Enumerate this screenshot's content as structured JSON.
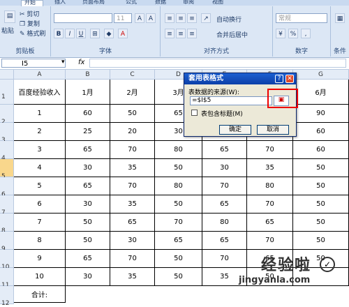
{
  "ribbon": {
    "tabs": [
      "开始",
      "插入",
      "页面布局",
      "公式",
      "数据",
      "审阅",
      "视图"
    ],
    "clipboard": {
      "paste": "粘贴",
      "cut": "剪切",
      "copy": "复制",
      "format_painter": "格式刷",
      "label": "剪贴板"
    },
    "font": {
      "size": "11",
      "label": "字体",
      "bold": "B",
      "italic": "I",
      "underline": "U"
    },
    "alignment": {
      "wrap": "自动换行",
      "merge": "合并后居中",
      "label": "对齐方式"
    },
    "number": {
      "format": "常规",
      "label": "数字",
      "percent": "%",
      "comma": ","
    },
    "styles_label": "条件"
  },
  "formula_bar": {
    "cell": "I5",
    "fx": "fx"
  },
  "sheet": {
    "columns": [
      "A",
      "B",
      "C",
      "D",
      "E",
      "F",
      "G"
    ],
    "header_row": [
      "百度经验收入",
      "1月",
      "2月",
      "3月",
      "",
      "",
      "6月"
    ],
    "rows": [
      [
        "1",
        "60",
        "50",
        "65",
        "",
        "",
        "90"
      ],
      [
        "2",
        "25",
        "20",
        "30",
        "",
        "",
        "60"
      ],
      [
        "3",
        "65",
        "70",
        "80",
        "65",
        "70",
        "60"
      ],
      [
        "4",
        "30",
        "35",
        "50",
        "30",
        "35",
        "50"
      ],
      [
        "5",
        "65",
        "70",
        "80",
        "70",
        "80",
        "50"
      ],
      [
        "6",
        "30",
        "35",
        "50",
        "65",
        "70",
        "50"
      ],
      [
        "7",
        "50",
        "65",
        "70",
        "80",
        "65",
        "50"
      ],
      [
        "8",
        "50",
        "30",
        "65",
        "65",
        "70",
        "50"
      ],
      [
        "9",
        "65",
        "70",
        "50",
        "70",
        "65",
        "50"
      ],
      [
        "10",
        "30",
        "35",
        "50",
        "35",
        "50",
        ""
      ]
    ],
    "total_label": "合计:",
    "row_numbers": [
      "1",
      "2",
      "3",
      "4",
      "5",
      "6",
      "7",
      "8",
      "9",
      "10",
      "11",
      "12"
    ]
  },
  "dialog": {
    "title": "套用表格式",
    "source_label": "表数据的来源(W):",
    "source_value": "=$I$5",
    "checkbox_label": "表包含标题(M)",
    "ok": "确定",
    "cancel": "取消"
  },
  "watermark": {
    "text": "经验啦",
    "sub": "jingyanla.com"
  }
}
